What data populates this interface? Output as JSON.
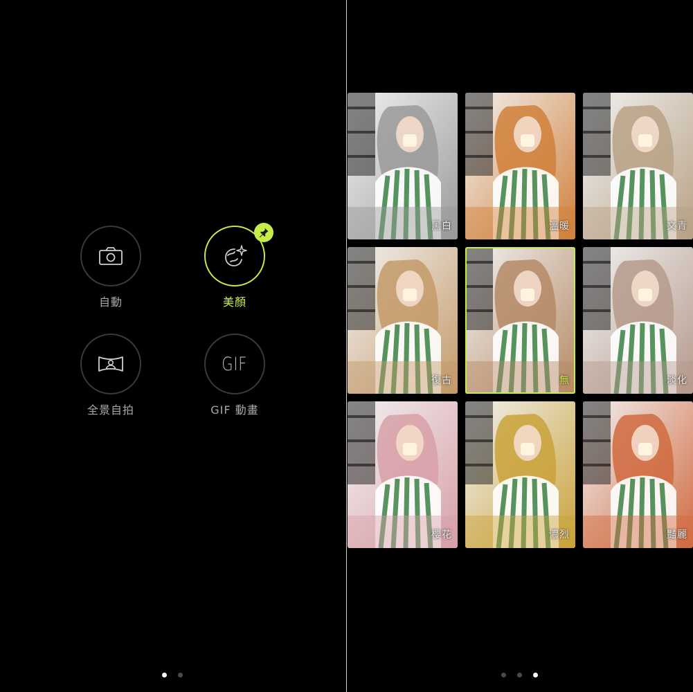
{
  "left_screen": {
    "modes": [
      {
        "id": "auto",
        "label": "自動",
        "icon": "camera-icon",
        "active": false
      },
      {
        "id": "beauty",
        "label": "美顏",
        "icon": "beauty-face-icon",
        "active": true,
        "pinned": true
      },
      {
        "id": "panorama-selfie",
        "label": "全景自拍",
        "icon": "panorama-selfie-icon",
        "active": false
      },
      {
        "id": "gif",
        "label": "GIF 動畫",
        "icon_text": "GIF",
        "icon": "gif-icon",
        "active": false
      }
    ],
    "page_dots": {
      "count": 2,
      "active_index": 0
    }
  },
  "right_screen": {
    "filters": [
      {
        "label": "黑白",
        "tint": "#9a9a9a",
        "selected": false
      },
      {
        "label": "溫暖",
        "tint": "#d0803a",
        "selected": false
      },
      {
        "label": "文青",
        "tint": "#b8a286",
        "selected": false
      },
      {
        "label": "復古",
        "tint": "#c49a6a",
        "selected": false
      },
      {
        "label": "無",
        "tint": "#b58a66",
        "selected": true
      },
      {
        "label": "淡化",
        "tint": "#b59a8c",
        "selected": false
      },
      {
        "label": "櫻花",
        "tint": "#d8a0a8",
        "selected": false
      },
      {
        "label": "濃烈",
        "tint": "#c9a23a",
        "selected": false
      },
      {
        "label": "豔麗",
        "tint": "#d06a40",
        "selected": false
      }
    ],
    "page_dots": {
      "count": 3,
      "active_index": 2
    }
  },
  "colors": {
    "accent": "#c6ec4a",
    "ring": "#3a3a3a",
    "label": "#a8a8a8",
    "background": "#000000"
  }
}
